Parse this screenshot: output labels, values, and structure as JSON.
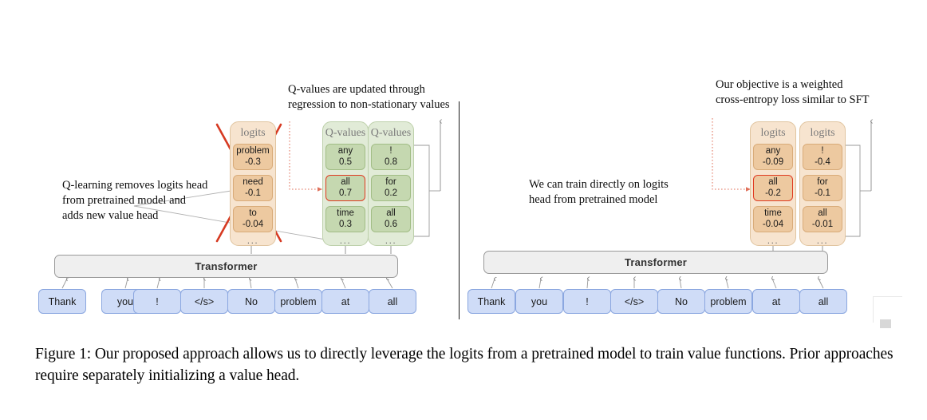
{
  "figure": {
    "caption": "Figure 1: Our proposed approach allows us to directly leverage the logits from a pretrained model to train value functions. Prior approaches require separately initializing a value head."
  },
  "left_panel": {
    "annotations": {
      "top": "Q-values are updated through\nregression to non-stationary values",
      "side": "Q-learning removes logits head\nfrom pretrained model and\nadds new value head"
    },
    "removed_stack": {
      "title": "logits",
      "crossed_out": true,
      "cells": [
        {
          "token": "problem",
          "value": "-0.3"
        },
        {
          "token": "need",
          "value": "-0.1"
        },
        {
          "token": "to",
          "value": "-0.04"
        }
      ],
      "ellipsis": "..."
    },
    "stacks": [
      {
        "title": "Q-values",
        "cells": [
          {
            "token": "any",
            "value": "0.5",
            "highlighted": false
          },
          {
            "token": "all",
            "value": "0.7",
            "highlighted": true
          },
          {
            "token": "time",
            "value": "0.3",
            "highlighted": false
          }
        ],
        "ellipsis": "..."
      },
      {
        "title": "Q-values",
        "cells": [
          {
            "token": "!",
            "value": "0.8",
            "highlighted": false
          },
          {
            "token": "for",
            "value": "0.2",
            "highlighted": false
          },
          {
            "token": "all",
            "value": "0.6",
            "highlighted": false
          }
        ],
        "ellipsis": "..."
      }
    ],
    "transformer": {
      "label": "Transformer"
    },
    "tokens": [
      "Thank",
      "you",
      "!",
      "</s>",
      "No",
      "problem",
      "at",
      "all"
    ]
  },
  "right_panel": {
    "annotations": {
      "top": "Our objective is a weighted\ncross-entropy loss similar to SFT",
      "side": "We can train directly on logits\nhead from pretrained model"
    },
    "stacks": [
      {
        "title": "logits",
        "cells": [
          {
            "token": "any",
            "value": "-0.09",
            "highlighted": false
          },
          {
            "token": "all",
            "value": "-0.2",
            "highlighted": true
          },
          {
            "token": "time",
            "value": "-0.04",
            "highlighted": false
          }
        ],
        "ellipsis": "..."
      },
      {
        "title": "logits",
        "cells": [
          {
            "token": "!",
            "value": "-0.4",
            "highlighted": false
          },
          {
            "token": "for",
            "value": "-0.1",
            "highlighted": false
          },
          {
            "token": "all",
            "value": "-0.01",
            "highlighted": false
          }
        ],
        "ellipsis": "..."
      }
    ],
    "transformer": {
      "label": "Transformer"
    },
    "tokens": [
      "Thank",
      "you",
      "!",
      "</s>",
      "No",
      "problem",
      "at",
      "all"
    ]
  },
  "colors": {
    "token_fill": "#cfdcf7",
    "token_border": "#8ba7e0",
    "logits_stack_fill": "#f7e4cf",
    "logits_cell_fill": "#edc9a0",
    "qvalue_stack_fill": "#e1ebd7",
    "qvalue_cell_fill": "#c5d8b0",
    "highlight": "#e03a21",
    "transformer_fill": "#efefef",
    "connector": "#9a9a9a"
  }
}
